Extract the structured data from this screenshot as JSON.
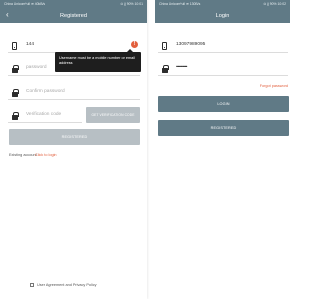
{
  "colors": {
    "header": "#607a86",
    "button_disabled": "#b7bfc4",
    "button_active": "#607a86",
    "link": "#e2603e",
    "tooltip_bg": "#1e1e1e"
  },
  "left_screen": {
    "status_bar": {
      "carrier": "China Unicom*ull ≋",
      "speed": "40kB/s",
      "right": "⊙ ∦ 90% 10:01"
    },
    "title": "Registered",
    "back_icon": "‹",
    "username": {
      "value": "144",
      "error_mark": "!"
    },
    "tooltip": "Username must be a mobile number or email address",
    "password": {
      "placeholder": "password"
    },
    "confirm_password": {
      "placeholder": "Confirm password"
    },
    "verification": {
      "placeholder": "Verification code",
      "button": "GET VERIFICATION CODE"
    },
    "register_button": "REGISTERED",
    "existing_account": "Existing account",
    "login_link": "Click to login",
    "agreement": "User Agreement and Privacy Policy"
  },
  "right_screen": {
    "status_bar": {
      "carrier": "China Unicom*ull ≋",
      "speed": "130B/s",
      "right": "⊙ ∦ 90% 10:02"
    },
    "title": "Login",
    "username": {
      "value": "13097989095"
    },
    "password": {
      "value": "••••••••••"
    },
    "forgot": "Forgot password",
    "login_button": "LOGIN",
    "register_button": "REGISTERED"
  }
}
